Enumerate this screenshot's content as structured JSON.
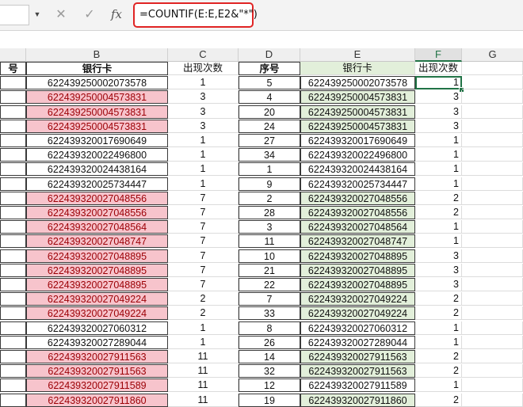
{
  "formula_bar": {
    "formula": "=COUNTIF(E:E,E2&\"*\")",
    "fx_label": "fx",
    "cancel_glyph": "✕",
    "enter_glyph": "✓"
  },
  "columns": [
    "B",
    "C",
    "D",
    "E",
    "F",
    "G"
  ],
  "left_table": {
    "header_a": "号",
    "header_bank": "银行卡",
    "header_count": "出现次数",
    "rows": [
      {
        "card": "622439250002073578",
        "count": "1",
        "dup": false
      },
      {
        "card": "622439250004573831",
        "count": "3",
        "dup": true
      },
      {
        "card": "622439250004573831",
        "count": "3",
        "dup": true
      },
      {
        "card": "622439250004573831",
        "count": "3",
        "dup": true
      },
      {
        "card": "622439320017690649",
        "count": "1",
        "dup": false
      },
      {
        "card": "622439320022496800",
        "count": "1",
        "dup": false
      },
      {
        "card": "622439320024438164",
        "count": "1",
        "dup": false
      },
      {
        "card": "622439320025734447",
        "count": "1",
        "dup": false
      },
      {
        "card": "622439320027048556",
        "count": "7",
        "dup": true
      },
      {
        "card": "622439320027048556",
        "count": "7",
        "dup": true
      },
      {
        "card": "622439320027048564",
        "count": "7",
        "dup": true
      },
      {
        "card": "622439320027048747",
        "count": "7",
        "dup": true
      },
      {
        "card": "622439320027048895",
        "count": "7",
        "dup": true
      },
      {
        "card": "622439320027048895",
        "count": "7",
        "dup": true
      },
      {
        "card": "622439320027048895",
        "count": "7",
        "dup": true
      },
      {
        "card": "622439320027049224",
        "count": "2",
        "dup": true
      },
      {
        "card": "622439320027049224",
        "count": "2",
        "dup": true
      },
      {
        "card": "622439320027060312",
        "count": "1",
        "dup": false
      },
      {
        "card": "622439320027289044",
        "count": "1",
        "dup": false
      },
      {
        "card": "622439320027911563",
        "count": "11",
        "dup": true
      },
      {
        "card": "622439320027911563",
        "count": "11",
        "dup": true
      },
      {
        "card": "622439320027911589",
        "count": "11",
        "dup": true
      },
      {
        "card": "622439320027911860",
        "count": "11",
        "dup": true
      }
    ]
  },
  "right_table": {
    "header_seq": "序号",
    "header_bank": "银行卡",
    "header_count": "出现次数",
    "rows": [
      {
        "seq": "5",
        "card": "622439250002073578",
        "count": "1",
        "dup": false
      },
      {
        "seq": "4",
        "card": "622439250004573831",
        "count": "3",
        "dup": true
      },
      {
        "seq": "20",
        "card": "622439250004573831",
        "count": "3",
        "dup": true
      },
      {
        "seq": "24",
        "card": "622439250004573831",
        "count": "3",
        "dup": true
      },
      {
        "seq": "27",
        "card": "622439320017690649",
        "count": "1",
        "dup": false
      },
      {
        "seq": "34",
        "card": "622439320022496800",
        "count": "1",
        "dup": false
      },
      {
        "seq": "1",
        "card": "622439320024438164",
        "count": "1",
        "dup": false
      },
      {
        "seq": "9",
        "card": "622439320025734447",
        "count": "1",
        "dup": false
      },
      {
        "seq": "2",
        "card": "622439320027048556",
        "count": "2",
        "dup": true
      },
      {
        "seq": "28",
        "card": "622439320027048556",
        "count": "2",
        "dup": true
      },
      {
        "seq": "3",
        "card": "622439320027048564",
        "count": "1",
        "dup": true
      },
      {
        "seq": "11",
        "card": "622439320027048747",
        "count": "1",
        "dup": true
      },
      {
        "seq": "10",
        "card": "622439320027048895",
        "count": "3",
        "dup": true
      },
      {
        "seq": "21",
        "card": "622439320027048895",
        "count": "3",
        "dup": true
      },
      {
        "seq": "22",
        "card": "622439320027048895",
        "count": "3",
        "dup": true
      },
      {
        "seq": "7",
        "card": "622439320027049224",
        "count": "2",
        "dup": true
      },
      {
        "seq": "33",
        "card": "622439320027049224",
        "count": "2",
        "dup": true
      },
      {
        "seq": "8",
        "card": "622439320027060312",
        "count": "1",
        "dup": false
      },
      {
        "seq": "26",
        "card": "622439320027289044",
        "count": "1",
        "dup": false
      },
      {
        "seq": "14",
        "card": "622439320027911563",
        "count": "2",
        "dup": true
      },
      {
        "seq": "32",
        "card": "622439320027911563",
        "count": "2",
        "dup": true
      },
      {
        "seq": "12",
        "card": "622439320027911589",
        "count": "1",
        "dup": false
      },
      {
        "seq": "19",
        "card": "622439320027911860",
        "count": "2",
        "dup": true
      }
    ]
  },
  "colors": {
    "duplicate_fill": "#f7c4cc",
    "duplicate_text": "#9c0006",
    "right_fill": "#e2efda",
    "active_accent": "#217346",
    "formula_highlight": "#e02424"
  }
}
